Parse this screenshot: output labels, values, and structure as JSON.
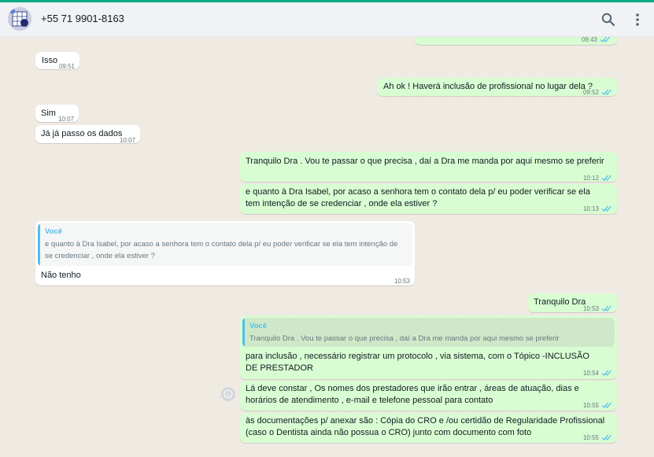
{
  "header": {
    "contact_name": "+55 71 9901-8163",
    "search_icon": "search-icon",
    "menu_icon": "kebab-menu-icon"
  },
  "colors": {
    "incoming": "#ffffff",
    "outgoing": "#d9fdd3",
    "accent": "#00a884",
    "quote_author": "#53bdeb",
    "ticks": "#53bdeb"
  },
  "messages": [
    {
      "dir": "out",
      "text": "",
      "time": "09:43"
    },
    {
      "dir": "in",
      "text": "Isso",
      "time": "09:51"
    },
    {
      "dir": "out",
      "text": "Ah ok ! Haverá inclusão de profissional no lugar dela ?",
      "time": "09:52"
    },
    {
      "dir": "in",
      "text": "Sim",
      "time": "10:07"
    },
    {
      "dir": "in",
      "text": "Já já passo os dados",
      "time": "10:07"
    },
    {
      "dir": "out",
      "text": "Tranquilo Dra . Vou te passar o que precisa , daí a Dra me manda por aqui mesmo se preferir",
      "time": "10:12"
    },
    {
      "dir": "out",
      "text": "e quanto à Dra Isabel, por acaso a senhora tem o contato dela p/ eu poder verificar se ela tem intenção de se credenciar , onde ela estiver ?",
      "time": "10:13"
    },
    {
      "dir": "in",
      "quote_author": "Você",
      "quote_text": "e quanto à Dra Isabel, por acaso a senhora tem o contato dela p/ eu poder verificar se ela tem intenção de se credenciar , onde ela estiver ?",
      "text": "Não tenho",
      "time": "10:53"
    },
    {
      "dir": "out",
      "text": "Tranquilo Dra",
      "time": "10:53"
    },
    {
      "dir": "out",
      "quote_author": "Você",
      "quote_text": "Tranquilo Dra . Vou te passar o que precisa , daí a Dra me manda por aqui mesmo se preferir",
      "text": "para inclusão , necessário registrar um protocolo , via sistema, com o Tópico -INCLUSÃO DE PRESTADOR",
      "time": "10:54"
    },
    {
      "dir": "out",
      "text": "Lá deve constar , Os nomes dos prestadores que irão entrar , áreas de atuação, dias e horários de atendimento , e-mail e telefone pessoal para contato",
      "time": "10:55"
    },
    {
      "dir": "out",
      "text": "às documentações p/ anexar são : Cópia do CRO e /ou certidão de Regularidade Profissional (caso o Dentista ainda não possua o CRO) junto com documento com foto",
      "time": "10:55"
    }
  ]
}
